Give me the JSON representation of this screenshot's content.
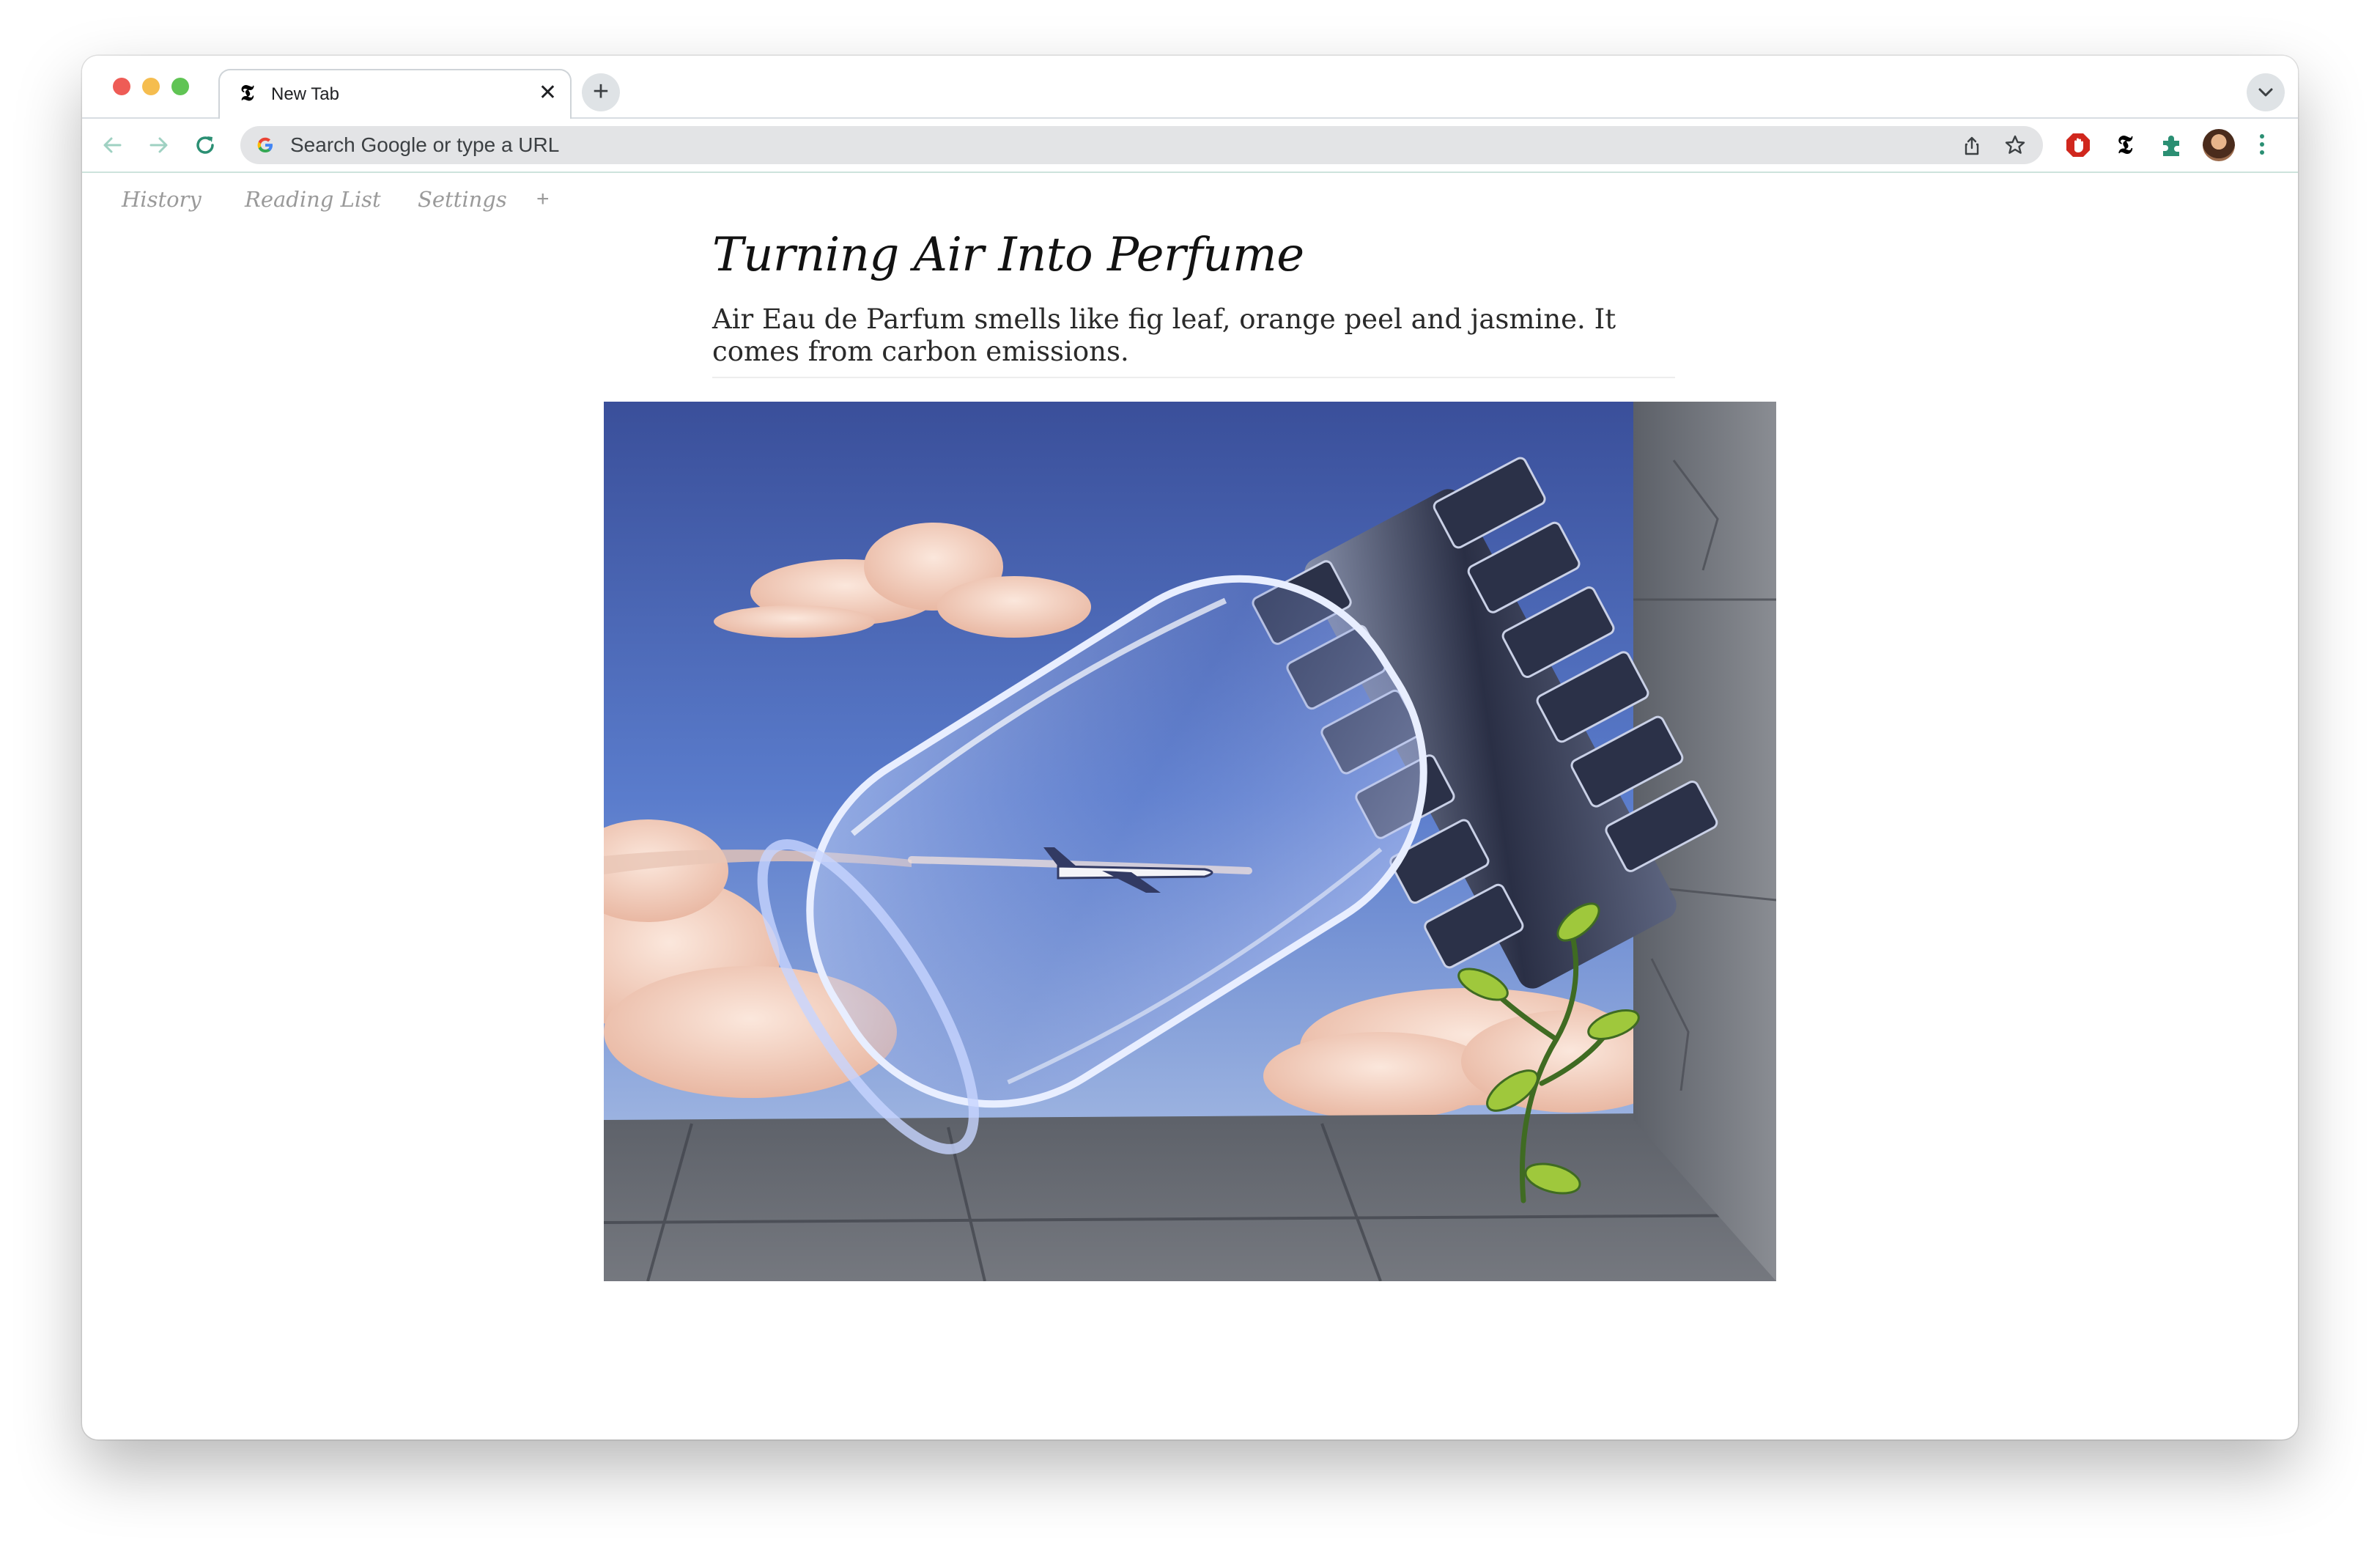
{
  "browser": {
    "tab": {
      "title": "New Tab",
      "close_glyph": "✕"
    },
    "new_tab_glyph": "+",
    "omnibox": {
      "placeholder": "Search Google or type a URL"
    },
    "icons": [
      "back-arrow-icon",
      "forward-arrow-icon",
      "reload-icon",
      "google-g-icon",
      "share-icon",
      "bookmark-star-icon",
      "adblock-extension-icon",
      "nyt-extension-icon",
      "extensions-puzzle-icon",
      "profile-avatar",
      "kebab-menu-icon",
      "tab-search-chevron-icon"
    ],
    "accent_color": "#2b8f73"
  },
  "bookmarks": {
    "items": [
      "History",
      "Reading List",
      "Settings"
    ],
    "add_glyph": "+"
  },
  "article": {
    "headline": "Turning Air Into Perfume",
    "summary": "Air Eau de Parfum smells like fig leaf, orange peel and jasmine. It comes from carbon emissions.",
    "illustration": "perfume-jar-illustration"
  }
}
